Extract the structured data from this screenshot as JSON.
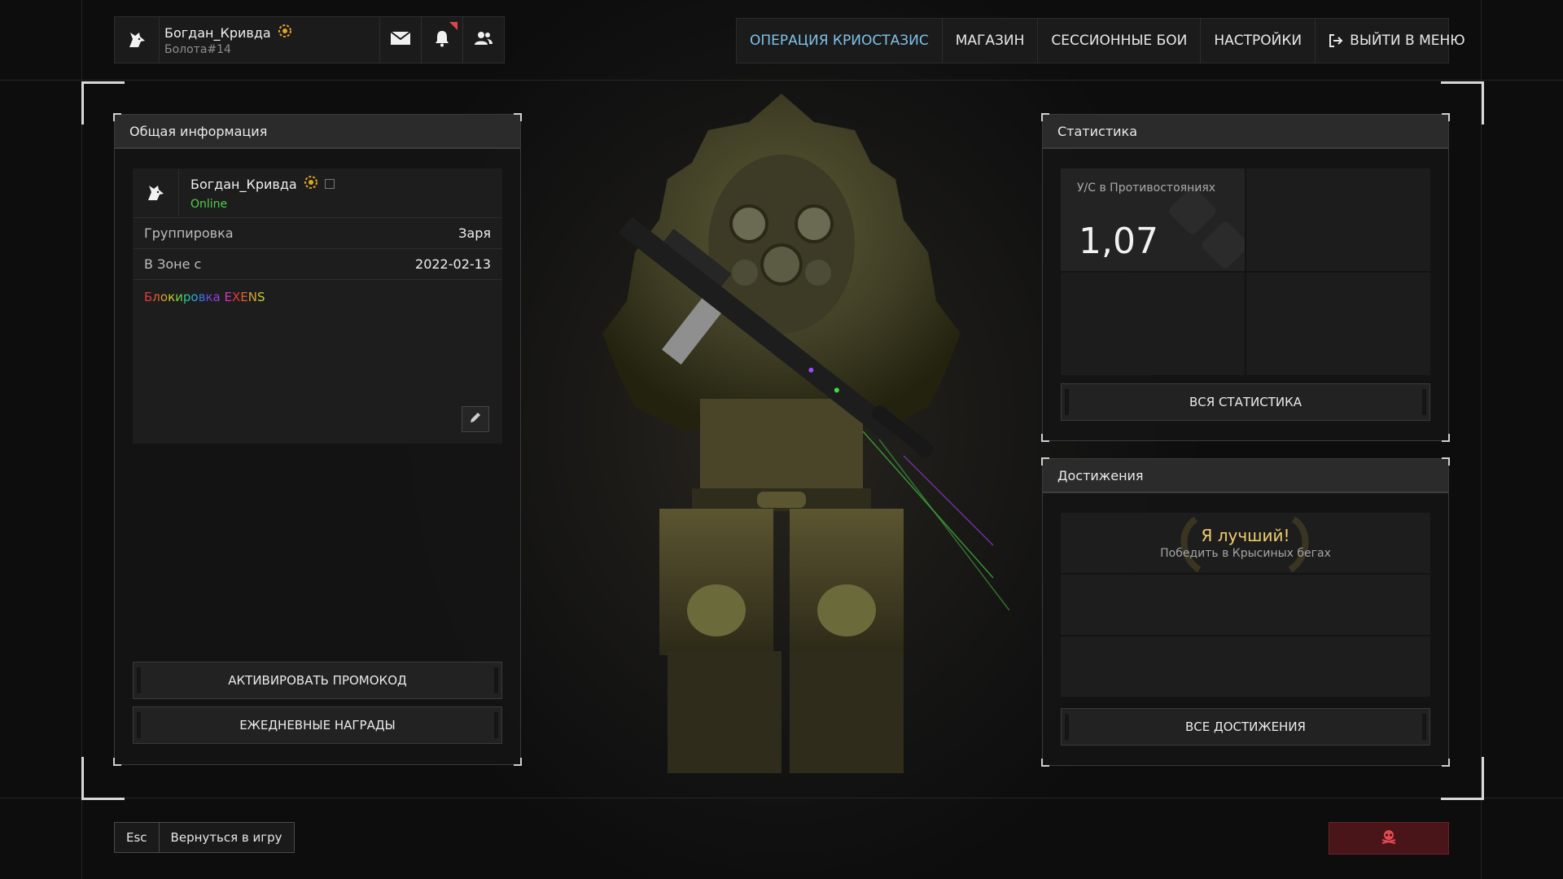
{
  "header": {
    "player_name": "Богдан_Кривда",
    "player_tag": "Болота#14",
    "icons": [
      "wolf-avatar-icon",
      "rank-badge-icon",
      "mail-icon",
      "bell-icon",
      "friends-icon"
    ]
  },
  "nav": {
    "items": [
      {
        "label": "ОПЕРАЦИЯ КРИОСТАЗИС"
      },
      {
        "label": "МАГАЗИН"
      },
      {
        "label": "СЕССИОННЫЕ БОИ"
      },
      {
        "label": "НАСТРОЙКИ"
      },
      {
        "label": "ВЫЙТИ В МЕНЮ"
      }
    ],
    "active_color": "#7ec2ea"
  },
  "general": {
    "title": "Общая информация",
    "player_name": "Богдан_Кривда",
    "status": "Online",
    "status_color": "#4fd04f",
    "rows": [
      {
        "label": "Группировка",
        "value": "Заря"
      },
      {
        "label": "В Зоне с",
        "value": "2022-02-13"
      }
    ],
    "clan_text": "Блокировка EXENS",
    "promo_button": "АКТИВИРОВАТЬ ПРОМОКОД",
    "daily_button": "ЕЖЕДНЕВНЫЕ НАГРАДЫ"
  },
  "stats": {
    "title": "Статистика",
    "kd_label": "У/С в Противостояниях",
    "kd_value": "1,07",
    "all_button": "ВСЯ СТАТИСТИКА"
  },
  "achievements": {
    "title": "Достижения",
    "items": [
      {
        "title": "Я лучший!",
        "desc": "Победить в Крысиных бегах"
      }
    ],
    "title_color": "#f0cd6e",
    "all_button": "ВСЕ ДОСТИЖЕНИЯ"
  },
  "footer": {
    "esc_key": "Esc",
    "esc_label": "Вернуться в игру",
    "danger_color": "#4a1519"
  }
}
